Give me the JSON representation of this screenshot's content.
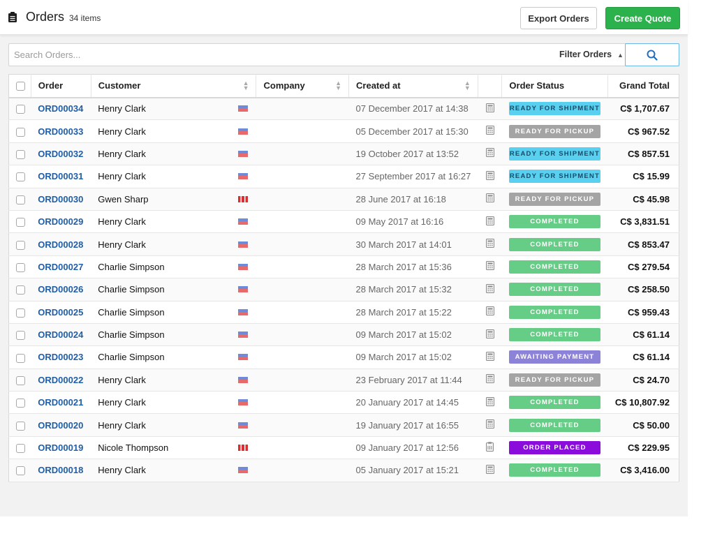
{
  "header": {
    "title": "Orders",
    "count": "34 items",
    "export_label": "Export Orders",
    "create_label": "Create Quote"
  },
  "search": {
    "placeholder": "Search Orders...",
    "value": "",
    "filter_label": "Filter Orders"
  },
  "colors": {
    "accent_green": "#2bb24c",
    "link_blue": "#1f5ea8",
    "status": {
      "ready_for_shipment": {
        "bg": "#5ad0f0",
        "fg": "#1a4a66"
      },
      "ready_for_pickup": {
        "bg": "#a4a4a4",
        "fg": "#ffffff"
      },
      "completed": {
        "bg": "#66cd87",
        "fg": "#ffffff"
      },
      "awaiting_payment": {
        "bg": "#8c83d9",
        "fg": "#ffffff"
      },
      "order_placed": {
        "bg": "#8a0ddc",
        "fg": "#ffffff"
      }
    }
  },
  "table": {
    "columns": [
      "Order",
      "Customer",
      "Company",
      "Created at",
      "",
      "Order Status",
      "Grand Total"
    ],
    "rows": [
      {
        "order": "ORD00034",
        "customer": "Henry Clark",
        "flag": "us",
        "company": "",
        "created": "07 December 2017 at 14:38",
        "icon": "calculator",
        "status": "READY FOR SHIPMENT",
        "status_key": "ready_for_shipment",
        "total": "C$ 1,707.67"
      },
      {
        "order": "ORD00033",
        "customer": "Henry Clark",
        "flag": "us",
        "company": "",
        "created": "05 December 2017 at 15:30",
        "icon": "calculator",
        "status": "READY FOR PICKUP",
        "status_key": "ready_for_pickup",
        "total": "C$ 967.52"
      },
      {
        "order": "ORD00032",
        "customer": "Henry Clark",
        "flag": "us",
        "company": "",
        "created": "19 October 2017 at 13:52",
        "icon": "calculator",
        "status": "READY FOR SHIPMENT",
        "status_key": "ready_for_shipment",
        "total": "C$ 857.51"
      },
      {
        "order": "ORD00031",
        "customer": "Henry Clark",
        "flag": "us",
        "company": "",
        "created": "27 September 2017 at 16:27",
        "icon": "calculator",
        "status": "READY FOR SHIPMENT",
        "status_key": "ready_for_shipment",
        "total": "C$ 15.99"
      },
      {
        "order": "ORD00030",
        "customer": "Gwen Sharp",
        "flag": "ca",
        "company": "",
        "created": "28 June 2017 at 16:18",
        "icon": "calculator",
        "status": "READY FOR PICKUP",
        "status_key": "ready_for_pickup",
        "total": "C$ 45.98"
      },
      {
        "order": "ORD00029",
        "customer": "Henry Clark",
        "flag": "us",
        "company": "",
        "created": "09 May 2017 at 16:16",
        "icon": "calculator",
        "status": "COMPLETED",
        "status_key": "completed",
        "total": "C$ 3,831.51"
      },
      {
        "order": "ORD00028",
        "customer": "Henry Clark",
        "flag": "us",
        "company": "",
        "created": "30 March 2017 at 14:01",
        "icon": "calculator",
        "status": "COMPLETED",
        "status_key": "completed",
        "total": "C$ 853.47"
      },
      {
        "order": "ORD00027",
        "customer": "Charlie Simpson",
        "flag": "us",
        "company": "",
        "created": "28 March 2017 at 15:36",
        "icon": "calculator",
        "status": "COMPLETED",
        "status_key": "completed",
        "total": "C$ 279.54"
      },
      {
        "order": "ORD00026",
        "customer": "Charlie Simpson",
        "flag": "us",
        "company": "",
        "created": "28 March 2017 at 15:32",
        "icon": "calculator",
        "status": "COMPLETED",
        "status_key": "completed",
        "total": "C$ 258.50"
      },
      {
        "order": "ORD00025",
        "customer": "Charlie Simpson",
        "flag": "us",
        "company": "",
        "created": "28 March 2017 at 15:22",
        "icon": "calculator",
        "status": "COMPLETED",
        "status_key": "completed",
        "total": "C$ 959.43"
      },
      {
        "order": "ORD00024",
        "customer": "Charlie Simpson",
        "flag": "us",
        "company": "",
        "created": "09 March 2017 at 15:02",
        "icon": "calculator",
        "status": "COMPLETED",
        "status_key": "completed",
        "total": "C$ 61.14"
      },
      {
        "order": "ORD00023",
        "customer": "Charlie Simpson",
        "flag": "us",
        "company": "",
        "created": "09 March 2017 at 15:02",
        "icon": "calculator",
        "status": "AWAITING PAYMENT",
        "status_key": "awaiting_payment",
        "total": "C$ 61.14"
      },
      {
        "order": "ORD00022",
        "customer": "Henry Clark",
        "flag": "us",
        "company": "",
        "created": "23 February 2017 at 11:44",
        "icon": "calculator",
        "status": "READY FOR PICKUP",
        "status_key": "ready_for_pickup",
        "total": "C$ 24.70"
      },
      {
        "order": "ORD00021",
        "customer": "Henry Clark",
        "flag": "us",
        "company": "",
        "created": "20 January 2017 at 14:45",
        "icon": "calculator",
        "status": "COMPLETED",
        "status_key": "completed",
        "total": "C$ 10,807.92"
      },
      {
        "order": "ORD00020",
        "customer": "Henry Clark",
        "flag": "us",
        "company": "",
        "created": "19 January 2017 at 16:55",
        "icon": "calculator",
        "status": "COMPLETED",
        "status_key": "completed",
        "total": "C$ 50.00"
      },
      {
        "order": "ORD00019",
        "customer": "Nicole Thompson",
        "flag": "ca",
        "company": "",
        "created": "09 January 2017 at 12:56",
        "icon": "clipboard",
        "status": "ORDER PLACED",
        "status_key": "order_placed",
        "total": "C$ 229.95"
      },
      {
        "order": "ORD00018",
        "customer": "Henry Clark",
        "flag": "us",
        "company": "",
        "created": "05 January 2017 at 15:21",
        "icon": "calculator",
        "status": "COMPLETED",
        "status_key": "completed",
        "total": "C$ 3,416.00"
      }
    ]
  }
}
